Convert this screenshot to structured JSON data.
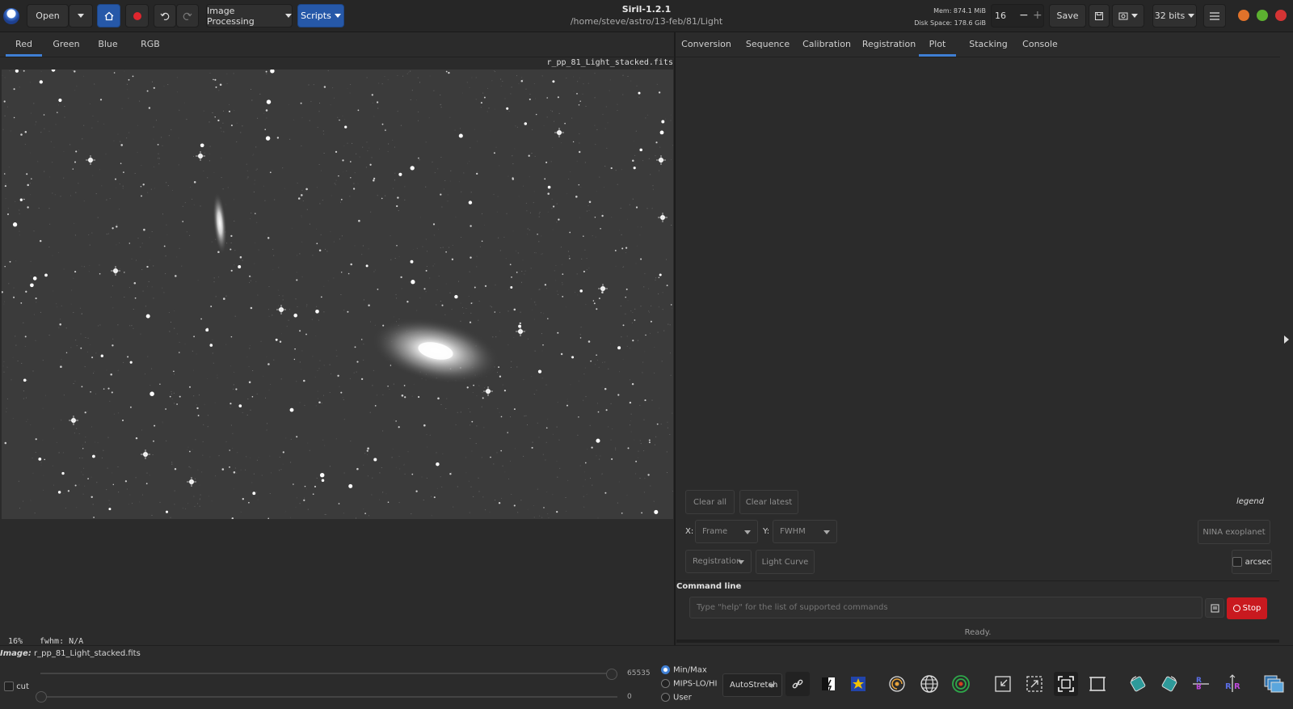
{
  "titlebar": {
    "app_title": "Siril-1.2.1",
    "path": "/home/steve/astro/13-feb/81/Light",
    "open_label": "Open",
    "image_processing_label": "Image Processing",
    "scripts_label": "Scripts",
    "mem": "Mem: 874.1 MiB",
    "disk": "Disk Space: 178.6 GiB",
    "threads": "16",
    "save_label": "Save",
    "bits_label": "32 bits"
  },
  "left_tabs": [
    {
      "label": "Red",
      "active": true
    },
    {
      "label": "Green",
      "active": false
    },
    {
      "label": "Blue",
      "active": false
    },
    {
      "label": "RGB",
      "active": false
    }
  ],
  "image_filename": "r_pp_81_Light_stacked.fits",
  "right_tabs": [
    {
      "label": "Conversion",
      "active": false
    },
    {
      "label": "Sequence",
      "active": false
    },
    {
      "label": "Calibration",
      "active": false
    },
    {
      "label": "Registration",
      "active": false
    },
    {
      "label": "Plot",
      "active": true
    },
    {
      "label": "Stacking",
      "active": false
    },
    {
      "label": "Console",
      "active": false
    }
  ],
  "plot": {
    "clear_all": "Clear all",
    "clear_latest": "Clear latest",
    "legend": "legend",
    "x_label": "X:",
    "x_value": "Frame",
    "y_label": "Y:",
    "y_value": "FWHM",
    "nina": "NINA exoplanet",
    "registration": "Registration",
    "light_curve": "Light Curve",
    "arcsec": "arcsec"
  },
  "command": {
    "title": "Command line",
    "placeholder": "Type \"help\" for the list of supported commands",
    "stop": "Stop",
    "status": "Ready."
  },
  "status": {
    "zoom": "16%",
    "fwhm": "fwhm: N/A",
    "image_prefix": "Image:",
    "image_name": "r_pp_81_Light_stacked.fits"
  },
  "bottom": {
    "cut": "cut",
    "max_value": "65535",
    "min_value": "0",
    "radio_minmax": "Min/Max",
    "radio_mips": "MIPS-LO/HI",
    "radio_user": "User",
    "stretch": "AutoStretch"
  }
}
